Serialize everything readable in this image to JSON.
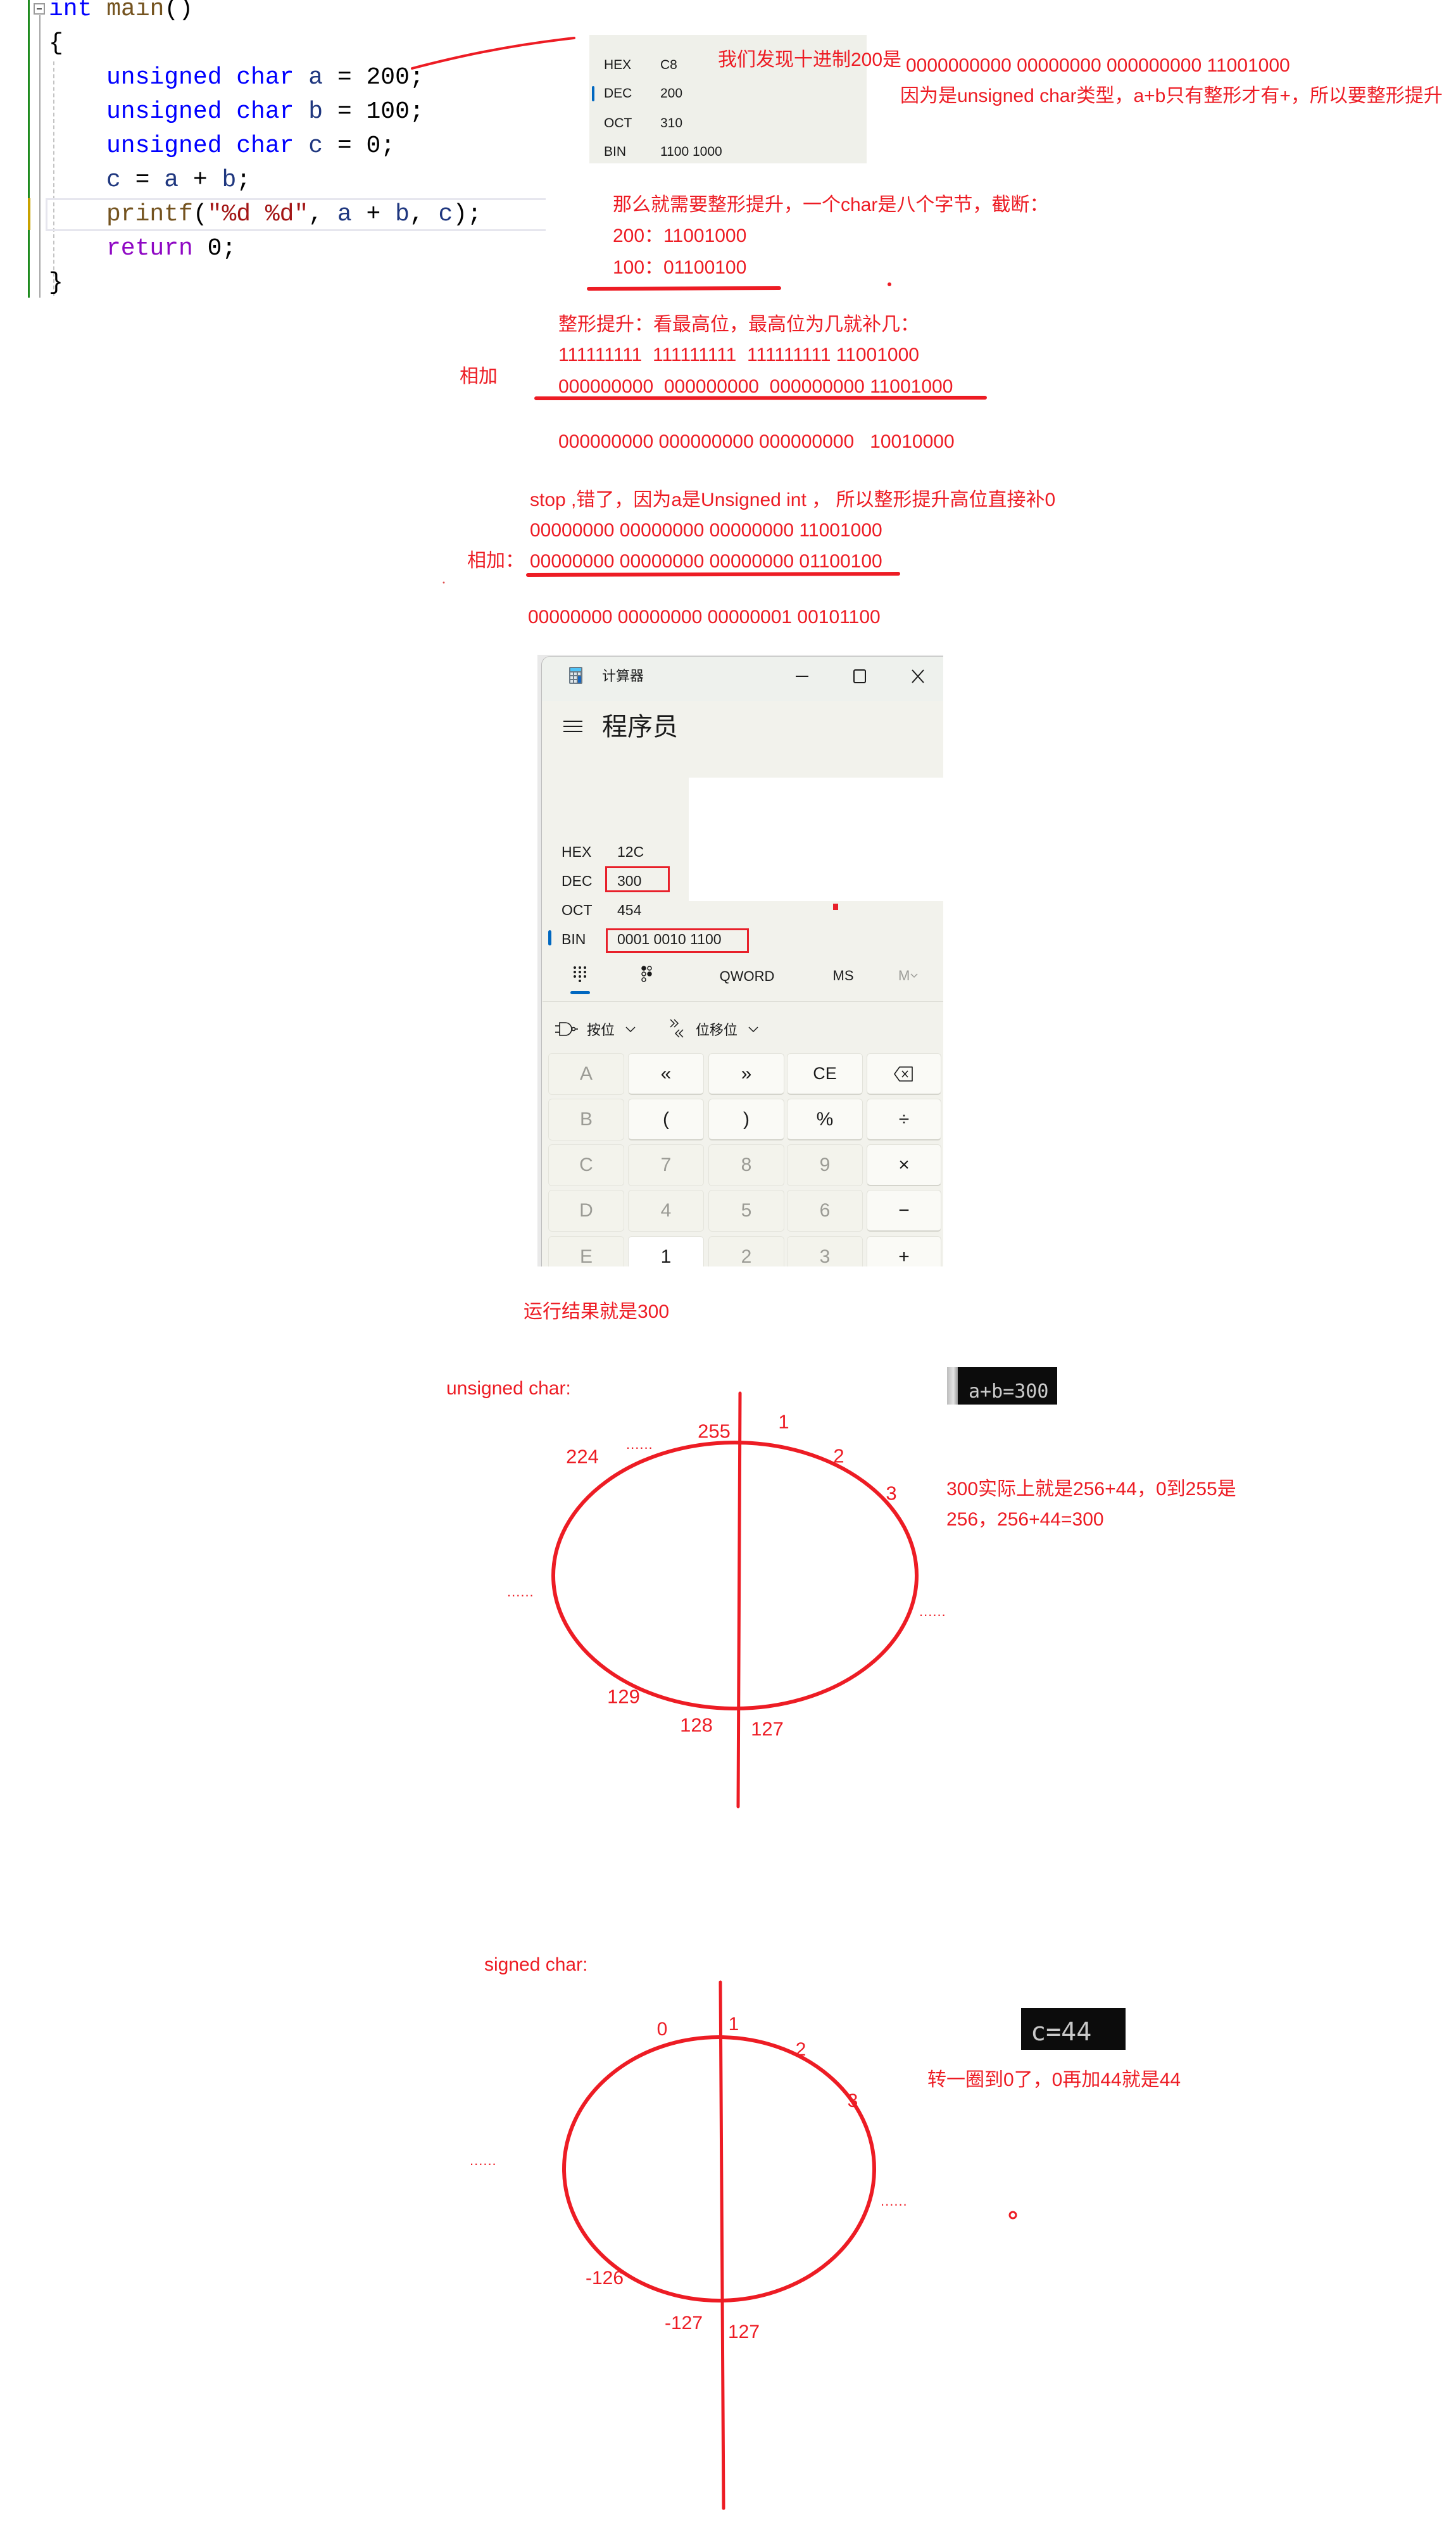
{
  "code_editor": {
    "lines": [
      [
        "int",
        " main",
        "()"
      ],
      [
        "{"
      ],
      [
        "unsigned char",
        " a",
        " = ",
        "200",
        ";"
      ],
      [
        "unsigned char",
        " b",
        " = ",
        "100",
        ";"
      ],
      [
        "unsigned char",
        " c",
        " = ",
        "0",
        ";"
      ],
      [
        "c",
        " = ",
        "a",
        " + ",
        "b",
        ";"
      ],
      [
        "printf",
        "(",
        "\"%d %d\"",
        ", ",
        "a",
        " + ",
        "b",
        ", ",
        "c",
        ");"
      ],
      [
        "return",
        " 0;"
      ],
      [
        "}"
      ]
    ],
    "highlighted_line": 7
  },
  "calc_snippet": {
    "rows": [
      {
        "label": "HEX",
        "value": "C8"
      },
      {
        "label": "DEC",
        "value": "200"
      },
      {
        "label": "OCT",
        "value": "310"
      },
      {
        "label": "BIN",
        "value": "1100 1000"
      }
    ],
    "active_row": "DEC"
  },
  "annotations": {
    "decimal_200_is": "我们发现十进制200是",
    "binary_200_32bit": "0000000000 00000000 000000000 11001000",
    "reason_promotion": "因为是unsigned char类型，a+b只有整形才有+，所以要整形提升",
    "need_promotion": "那么就需要整形提升，一个char是八个字节，截断：",
    "bin_200": "200：11001000",
    "bin_100": "100：01100100",
    "promotion_rule": "整形提升：看最高位，最高位为几就补几：",
    "sign_ext_row1": "111111111  111111111  111111111 11001000",
    "sign_ext_row2": "000000000  000000000  000000000 11001000",
    "add_label_1": "相加",
    "wrong_sum": "000000000 000000000 000000000   10010000",
    "correction": "stop ,错了，因为a是Unsigned int ， 所以整形提升高位直接补0",
    "zero_ext_a": "00000000 00000000 00000000 11001000",
    "add_label_2": "相加：",
    "zero_ext_b": "00000000 00000000 00000000 01100100",
    "correct_sum": "00000000 00000000 00000001 00101100",
    "result_300": "运行结果就是300"
  },
  "calculator": {
    "title": "计算器",
    "mode": "程序员",
    "readouts": [
      {
        "label": "HEX",
        "value": "12C"
      },
      {
        "label": "DEC",
        "value": "300"
      },
      {
        "label": "OCT",
        "value": "454"
      },
      {
        "label": "BIN",
        "value": "0001 0010 1100"
      }
    ],
    "active_radix": "BIN",
    "word_size": "QWORD",
    "memory_store": "MS",
    "memory_menu": "M",
    "bitwise": "按位",
    "bit_shift": "位移位",
    "keys": [
      [
        {
          "label": "A",
          "enabled": false
        },
        {
          "label": "«",
          "enabled": true
        },
        {
          "label": "»",
          "enabled": true
        },
        {
          "label": "CE",
          "enabled": true
        },
        {
          "icon": "backspace-icon",
          "enabled": true
        }
      ],
      [
        {
          "label": "B",
          "enabled": false
        },
        {
          "label": "(",
          "enabled": true
        },
        {
          "label": ")",
          "enabled": true
        },
        {
          "label": "%",
          "enabled": true
        },
        {
          "label": "÷",
          "enabled": true
        }
      ],
      [
        {
          "label": "C",
          "enabled": false
        },
        {
          "label": "7",
          "enabled": false
        },
        {
          "label": "8",
          "enabled": false
        },
        {
          "label": "9",
          "enabled": false
        },
        {
          "label": "×",
          "enabled": true
        }
      ],
      [
        {
          "label": "D",
          "enabled": false
        },
        {
          "label": "4",
          "enabled": false
        },
        {
          "label": "5",
          "enabled": false
        },
        {
          "label": "6",
          "enabled": false
        },
        {
          "label": "−",
          "enabled": true
        }
      ],
      [
        {
          "label": "E",
          "enabled": false
        },
        {
          "label": "1",
          "enabled": true
        },
        {
          "label": "2",
          "enabled": false
        },
        {
          "label": "3",
          "enabled": false
        },
        {
          "label": "+",
          "enabled": true
        }
      ]
    ]
  },
  "unsigned_diagram": {
    "title": "unsigned char:",
    "labels": {
      "top_left": "255",
      "top_right": "1",
      "upper_left": "224",
      "upper_left_dots": "......",
      "right_1": "2",
      "right_2": "3",
      "left_dots": "......",
      "right_dots": "......",
      "lower_left": "129",
      "bottom_left": "128",
      "bottom_right": "127"
    },
    "console_output": "a+b=300",
    "note_line1": "300实际上就是256+44，0到255是",
    "note_line2": "256，256+44=300"
  },
  "signed_diagram": {
    "title": "signed char:",
    "labels": {
      "top_left": "0",
      "top_right": "1",
      "right_1": "2",
      "right_2": "3",
      "left_dots": "......",
      "right_dots": "......",
      "lower_left": "-126",
      "bottom_left": "-127",
      "bottom_right": "127"
    },
    "console_output": "c=44",
    "note": "转一圈到0了，0再加44就是44"
  },
  "colors": {
    "annotation_red": "#ed1c24",
    "keyword_blue": "#0000ff",
    "calculator_accent": "#0067c0",
    "console_bg": "#0c0c0c",
    "console_text": "#cccccc"
  }
}
